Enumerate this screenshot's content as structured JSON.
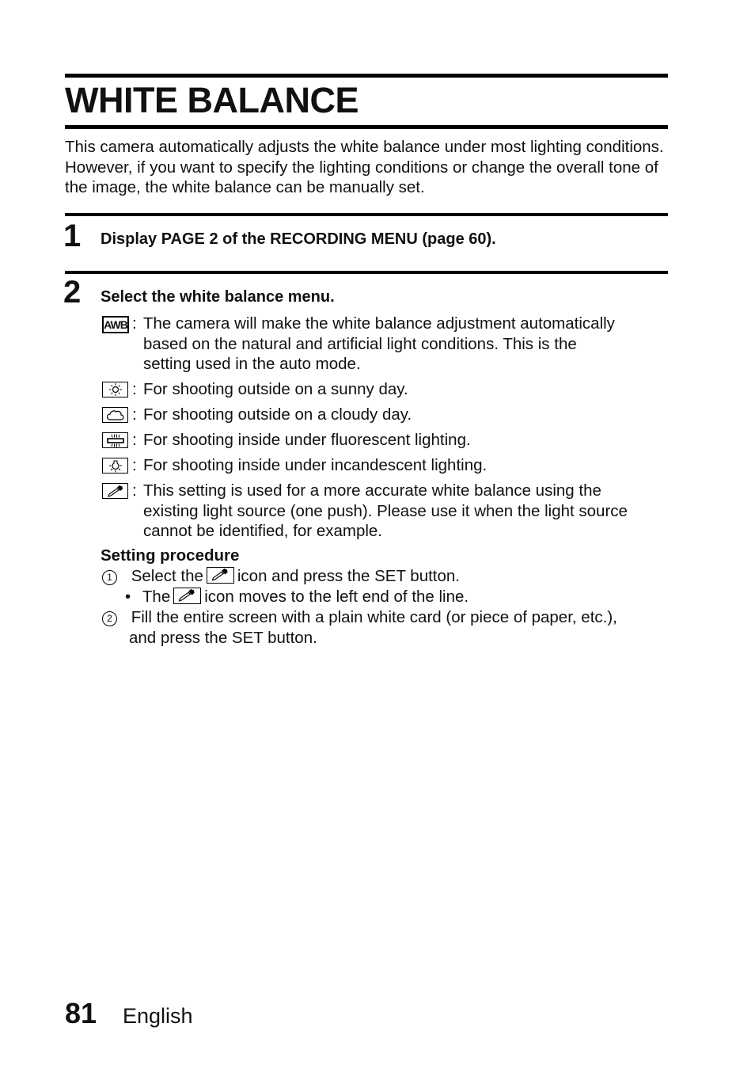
{
  "page": {
    "title": "WHITE BALANCE",
    "intro": "This camera automatically adjusts the white balance under most lighting conditions. However, if you want to specify the lighting conditions or change the overall tone of the image, the white balance can be manually set.",
    "steps": [
      {
        "number": "1",
        "text": "Display PAGE 2 of the RECORDING MENU (page 60)."
      },
      {
        "number": "2",
        "text": "Select the white balance menu."
      }
    ],
    "options": [
      {
        "icon": "awb-icon",
        "icon_label": "AWB",
        "lines": [
          "The camera will make the white balance adjustment automatically",
          "based on the natural and artificial light conditions. This is the",
          "setting used in the auto mode."
        ]
      },
      {
        "icon": "sunny-icon",
        "lines": [
          "For shooting outside on a sunny day."
        ]
      },
      {
        "icon": "cloudy-icon",
        "lines": [
          "For shooting outside on a cloudy day."
        ]
      },
      {
        "icon": "fluorescent-icon",
        "lines": [
          "For shooting inside under fluorescent lighting."
        ]
      },
      {
        "icon": "incandescent-icon",
        "lines": [
          "For shooting inside under incandescent lighting."
        ]
      },
      {
        "icon": "one-push-eyedropper-icon",
        "lines": [
          "This setting is used for a more accurate white balance using the",
          "existing light source (one push). Please use it when the light source",
          "cannot be identified, for example."
        ]
      }
    ],
    "colon": ":",
    "procedure": {
      "heading": "Setting procedure",
      "step1_marker": "1",
      "step1_before": "Select the",
      "step1_after": "icon and press the SET button.",
      "bullet": "•",
      "bullet_before": "The",
      "bullet_after": "icon moves to the left end of the line.",
      "step2_marker": "2",
      "step2_line1": "Fill the entire screen with a plain white card (or piece of paper, etc.),",
      "step2_line2": "and press the SET button."
    },
    "footer": {
      "page_number": "81",
      "language": "English"
    }
  }
}
